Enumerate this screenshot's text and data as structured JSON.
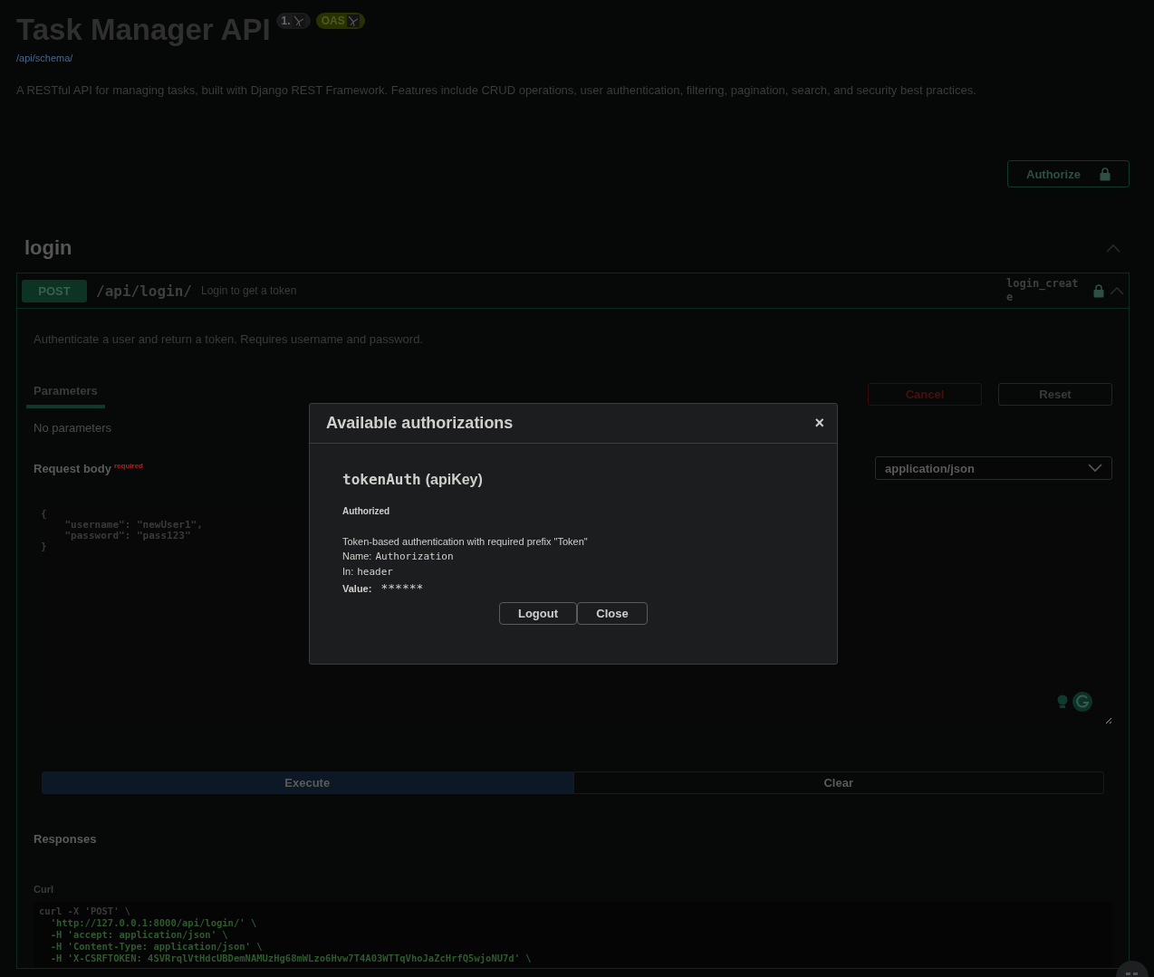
{
  "header": {
    "title": "Task Manager API",
    "version_badge": "1.",
    "oas_badge": "OAS",
    "schema_link": "/api/schema/",
    "description": "A RESTful API for managing tasks, built with Django REST Framework. Features include CRUD operations, user authentication, filtering, pagination, search, and security best practices."
  },
  "authorize_button": {
    "label": "Authorize",
    "locked": true
  },
  "section": {
    "title": "login",
    "expanded": true
  },
  "operation": {
    "method": "POST",
    "path": "/api/login/",
    "summary": "Login to get a token",
    "operation_id": "login_create",
    "locked": true,
    "description": "Authenticate a user and return a token. Requires username and password.",
    "tabs": [
      {
        "label": "Parameters",
        "selected": true
      }
    ],
    "cancel_button": "Cancel",
    "reset_button": "Reset",
    "no_parameters": "No parameters",
    "request_body": {
      "label": "Request body",
      "required": "required",
      "content_type": "application/json",
      "value": "{\n    \"username\": \"newUser1\",\n    \"password\": \"pass123\"\n}"
    },
    "execute_button": "Execute",
    "clear_button": "Clear",
    "responses_title": "Responses",
    "curl_label": "Curl",
    "curl_lines": [
      "curl -X 'POST' \\",
      "  'http://127.0.0.1:8000/api/login/' \\",
      "  -H 'accept: application/json' \\",
      "  -H 'Content-Type: application/json' \\",
      "  -H 'X-CSRFTOKEN: 4SVRrqlVtHdcUBDemNAMUzHg68mWLzo6Hvw7T4A03WTTqVhoJaZcHrfQ5wjoNU7d' \\"
    ]
  },
  "modal": {
    "title": "Available authorizations",
    "close_glyph": "×",
    "scheme_name": "tokenAuth",
    "scheme_type": "(apiKey)",
    "status": "Authorized",
    "description": "Token-based authentication with required prefix \"Token\"",
    "name_label": "Name:",
    "name_value": "Authorization",
    "in_label": "In:",
    "in_value": "header",
    "value_label": "Value:",
    "value": "******",
    "buttons": [
      "Logout",
      "Close"
    ]
  }
}
